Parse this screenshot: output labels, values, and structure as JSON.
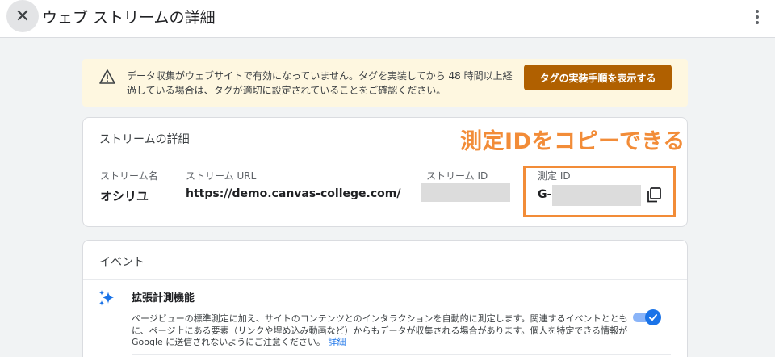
{
  "header": {
    "close_glyph": "✕",
    "title": "ウェブ ストリームの詳細",
    "more_icon": "more-vert-icon"
  },
  "banner": {
    "icon": "warning-icon",
    "message": "データ収集がウェブサイトで有効になっていません。タグを実装してから 48 時間以上経過している場合は、タグが適切に設定されていることをご確認ください。",
    "button_label": "タグの実装手順を表示する"
  },
  "stream_details": {
    "header": "ストリームの詳細",
    "name_label": "ストリーム名",
    "name_value": "オシリユ",
    "url_label": "ストリーム URL",
    "url_value": "https://demo.canvas-college.com/",
    "id_label": "ストリーム ID",
    "measurement_label": "測定 ID",
    "measurement_prefix": "G-",
    "copy_icon": "copy-icon"
  },
  "annotation": {
    "text": "測定IDをコピーできる",
    "color": "#f28c38"
  },
  "events": {
    "header": "イベント",
    "enhanced_title": "拡張計測機能",
    "enhanced_icon": "sparkle-icon",
    "enhanced_desc": "ページビューの標準測定に加え、サイトのコンテンツとのインタラクションを自動的に測定します。関連するイベントとともに、ページ上にある要素（リンクや埋め込み動画など）からもデータが収集される場合があります。個人を特定できる情報が Google に送信されないようにご注意ください。",
    "more_link": "詳細",
    "toggle_on": true
  },
  "colors": {
    "accent": "#1a73e8",
    "banner_button": "#b06000",
    "banner_bg": "#fef7e0"
  }
}
